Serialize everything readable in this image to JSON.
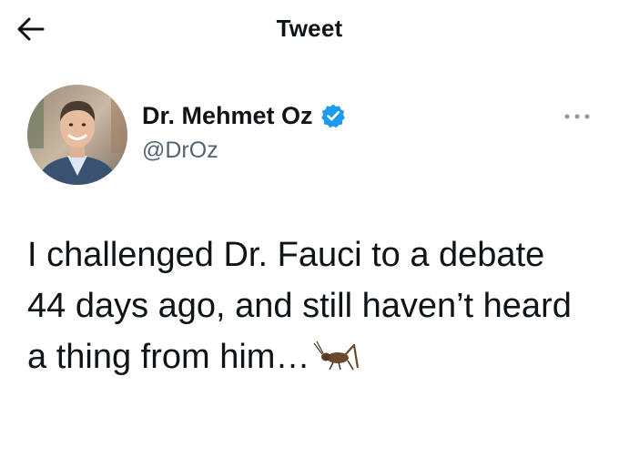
{
  "header": {
    "title": "Tweet",
    "back_icon": "arrow-left-icon"
  },
  "author": {
    "display_name": "Dr. Mehmet Oz",
    "handle": "@DrOz",
    "verified_icon": "verified-badge-icon",
    "avatar_icon": "profile-avatar"
  },
  "more_icon": "more-options-icon",
  "tweet": {
    "text": "I challenged Dr. Fauci to a debate 44 days ago, and still haven’t heard a thing from him…",
    "emoji_icon": "cricket-emoji-icon"
  },
  "colors": {
    "text": "#0f1419",
    "secondary": "#536471",
    "verified_blue": "#1d9bf0",
    "background": "#ffffff"
  }
}
